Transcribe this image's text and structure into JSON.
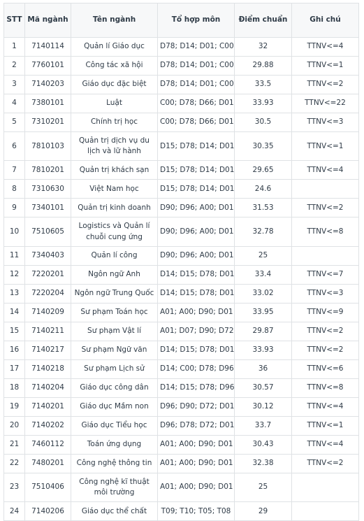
{
  "table": {
    "caption": "",
    "columns": [
      {
        "key": "stt",
        "label": "STT"
      },
      {
        "key": "ma_nganh",
        "label": "Mã ngành"
      },
      {
        "key": "ten_nganh",
        "label": "Tên ngành"
      },
      {
        "key": "to_hop_mon",
        "label": "Tổ hợp môn"
      },
      {
        "key": "diem_chuan",
        "label": "Điểm chuẩn"
      },
      {
        "key": "ghi_chu",
        "label": "Ghi chú"
      }
    ],
    "rows": [
      {
        "stt": "1",
        "ma_nganh": "7140114",
        "ten_nganh": "Quản lí Giáo dục",
        "to_hop_mon": "D78; D14; D01; C00",
        "diem_chuan": "32",
        "ghi_chu": "TTNV<=4"
      },
      {
        "stt": "2",
        "ma_nganh": "7760101",
        "ten_nganh": "Công tác xã hội",
        "to_hop_mon": "D78; D14; D01; C00",
        "diem_chuan": "29.88",
        "ghi_chu": "TTNV<=1"
      },
      {
        "stt": "3",
        "ma_nganh": "7140203",
        "ten_nganh": "Giáo dục đặc biệt",
        "to_hop_mon": "D78; D14; D01; C00",
        "diem_chuan": "33.5",
        "ghi_chu": "TTNV<=2"
      },
      {
        "stt": "4",
        "ma_nganh": "7380101",
        "ten_nganh": "Luật",
        "to_hop_mon": "C00; D78; D66; D01",
        "diem_chuan": "33.93",
        "ghi_chu": "TTNV<=22"
      },
      {
        "stt": "5",
        "ma_nganh": "7310201",
        "ten_nganh": "Chính trị học",
        "to_hop_mon": "C00; D78; D66; D01",
        "diem_chuan": "30.5",
        "ghi_chu": "TTNV<=3"
      },
      {
        "stt": "6",
        "ma_nganh": "7810103",
        "ten_nganh": "Quản trị dịch vụ du lịch và lữ hành",
        "to_hop_mon": "D15; D78; D14; D01",
        "diem_chuan": "30.35",
        "ghi_chu": "TTNV<=1"
      },
      {
        "stt": "7",
        "ma_nganh": "7810201",
        "ten_nganh": "Quản trị khách sạn",
        "to_hop_mon": "D15; D78; D14; D01",
        "diem_chuan": "29.65",
        "ghi_chu": "TTNV<=4"
      },
      {
        "stt": "8",
        "ma_nganh": "7310630",
        "ten_nganh": "Việt Nam học",
        "to_hop_mon": "D15; D78; D14; D01",
        "diem_chuan": "24.6",
        "ghi_chu": ""
      },
      {
        "stt": "9",
        "ma_nganh": "7340101",
        "ten_nganh": "Quản trị kinh doanh",
        "to_hop_mon": "D90; D96; A00; D01",
        "diem_chuan": "31.53",
        "ghi_chu": "TTNV<=2"
      },
      {
        "stt": "10",
        "ma_nganh": "7510605",
        "ten_nganh": "Logistics và Quản lí chuỗi cung ứng",
        "to_hop_mon": "D90; D96; A00; D01",
        "diem_chuan": "32.78",
        "ghi_chu": "TTNV<=8"
      },
      {
        "stt": "11",
        "ma_nganh": "7340403",
        "ten_nganh": "Quản lí công",
        "to_hop_mon": "D90; D96; A00; D01",
        "diem_chuan": "25",
        "ghi_chu": ""
      },
      {
        "stt": "12",
        "ma_nganh": "7220201",
        "ten_nganh": "Ngôn ngữ Anh",
        "to_hop_mon": "D14; D15; D78; D01",
        "diem_chuan": "33.4",
        "ghi_chu": "TTNV<=7"
      },
      {
        "stt": "13",
        "ma_nganh": "7220204",
        "ten_nganh": "Ngôn ngữ Trung Quốc",
        "to_hop_mon": "D14; D15; D78; D01",
        "diem_chuan": "33.02",
        "ghi_chu": "TTNV<=3"
      },
      {
        "stt": "14",
        "ma_nganh": "7140209",
        "ten_nganh": "Sư phạm Toán học",
        "to_hop_mon": "A01; A00; D90; D01",
        "diem_chuan": "33.95",
        "ghi_chu": "TTNV<=9"
      },
      {
        "stt": "15",
        "ma_nganh": "7140211",
        "ten_nganh": "Sư phạm Vật lí",
        "to_hop_mon": "A01; D07; D90; D72",
        "diem_chuan": "29.87",
        "ghi_chu": "TTNV<=2"
      },
      {
        "stt": "16",
        "ma_nganh": "7140217",
        "ten_nganh": "Sư phạm Ngữ văn",
        "to_hop_mon": "D14; D15; D78; D01",
        "diem_chuan": "33.93",
        "ghi_chu": "TTNV<=2"
      },
      {
        "stt": "17",
        "ma_nganh": "7140218",
        "ten_nganh": "Sư phạm Lịch sử",
        "to_hop_mon": "D14; C00; D78; D96",
        "diem_chuan": "36",
        "ghi_chu": "TTNV<=6"
      },
      {
        "stt": "18",
        "ma_nganh": "7140204",
        "ten_nganh": "Giáo dục công dân",
        "to_hop_mon": "D14; D15; D78; D96",
        "diem_chuan": "30.57",
        "ghi_chu": "TTNV<=8"
      },
      {
        "stt": "19",
        "ma_nganh": "7140201",
        "ten_nganh": "Giáo dục Mầm non",
        "to_hop_mon": "D96; D90; D72; D01",
        "diem_chuan": "30.12",
        "ghi_chu": "TTNV<=4"
      },
      {
        "stt": "20",
        "ma_nganh": "7140202",
        "ten_nganh": "Giáo dục Tiểu học",
        "to_hop_mon": "D96; D78; D72; D01",
        "diem_chuan": "33.7",
        "ghi_chu": "TTNV<=1"
      },
      {
        "stt": "21",
        "ma_nganh": "7460112",
        "ten_nganh": "Toán ứng dụng",
        "to_hop_mon": "A01; A00; D90; D01",
        "diem_chuan": "30.43",
        "ghi_chu": "TTNV<=4"
      },
      {
        "stt": "22",
        "ma_nganh": "7480201",
        "ten_nganh": "Công nghệ thông tin",
        "to_hop_mon": "A01; A00; D90; D01",
        "diem_chuan": "32.38",
        "ghi_chu": "TTNV<=2"
      },
      {
        "stt": "23",
        "ma_nganh": "7510406",
        "ten_nganh": "Công nghệ kĩ thuật môi trường",
        "to_hop_mon": "A01; A00; D90; D01",
        "diem_chuan": "25",
        "ghi_chu": ""
      },
      {
        "stt": "24",
        "ma_nganh": "7140206",
        "ten_nganh": "Giáo dục thể chất",
        "to_hop_mon": "T09; T10; T05; T08",
        "diem_chuan": "29",
        "ghi_chu": ""
      }
    ]
  },
  "colors": {
    "text": "#2f3b47",
    "border": "#dfe2e5",
    "header_background": "#f7f8f9",
    "row_background": "#ffffff"
  }
}
